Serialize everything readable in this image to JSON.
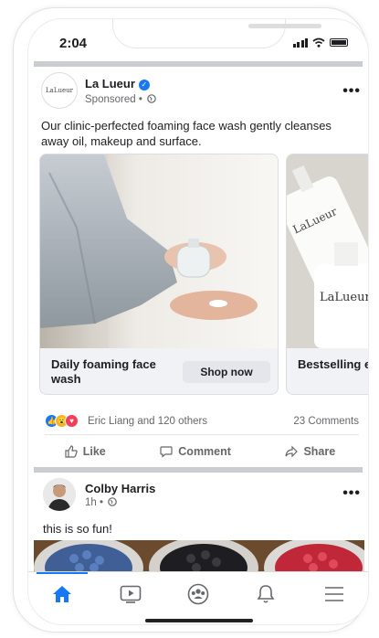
{
  "status_bar": {
    "time": "2:04"
  },
  "ad_post": {
    "page_name": "La Lueur",
    "avatar_text": "LaLueur",
    "meta": "Sponsored •",
    "caption": "Our clinic-perfected foaming face wash gently cleanses away oil, makeup and surface.",
    "cards": [
      {
        "title": "Daily foaming face wash",
        "cta": "Shop now"
      },
      {
        "title": "Bestselling everyday r",
        "cta": ""
      }
    ],
    "product_label": "LaLueur",
    "reactions_text": "Eric Liang and 120 others",
    "comments_text": "23 Comments",
    "actions": {
      "like": "Like",
      "comment": "Comment",
      "share": "Share"
    }
  },
  "second_post": {
    "author": "Colby Harris",
    "meta": "1h •",
    "text": "this is so fun!"
  },
  "colors": {
    "accent": "#1877f2",
    "divider": "#c9ccd1"
  },
  "icons": [
    "home-icon",
    "watch-icon",
    "groups-icon",
    "bell-icon",
    "menu-icon"
  ]
}
